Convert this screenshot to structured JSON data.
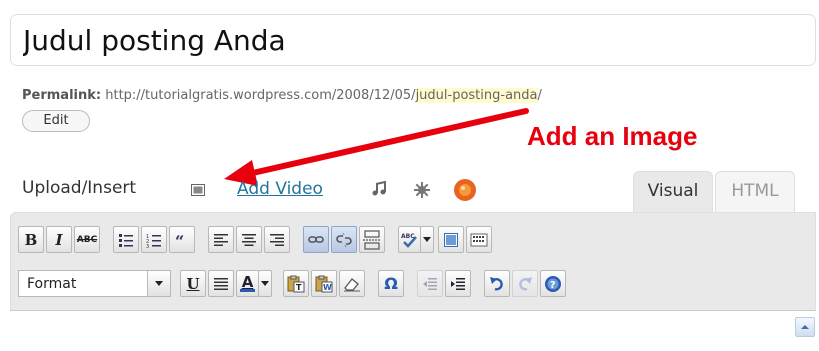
{
  "post": {
    "title": "Judul posting Anda"
  },
  "permalink": {
    "label": "Permalink:",
    "url_prefix": "http://tutorialgratis.wordpress.com/2008/12/05/",
    "slug": "judul-posting-anda",
    "url_suffix": "/",
    "edit_label": "Edit"
  },
  "annotation": {
    "text": "Add an Image",
    "color": "#e8000d"
  },
  "media": {
    "label": "Upload/Insert",
    "add_video_label": "Add Video",
    "icons": [
      "add-image-icon",
      "add-audio-icon",
      "add-media-icon",
      "polldaddy-icon"
    ]
  },
  "tabs": {
    "visual": "Visual",
    "html": "HTML",
    "active": "Visual"
  },
  "toolbar": {
    "bold": "B",
    "italic": "I",
    "strikethrough": "ABC",
    "format_select": "Format",
    "underline": "U",
    "text_color": "A",
    "special_char": "Ω"
  }
}
